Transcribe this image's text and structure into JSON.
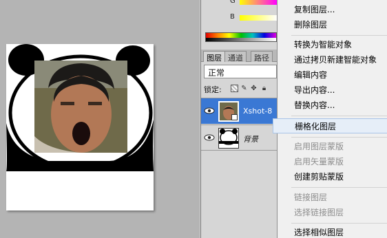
{
  "color_panel": {
    "g_channel": "G",
    "b_channel": "B"
  },
  "layers_panel": {
    "tabs": [
      "图层",
      "通道",
      "路径"
    ],
    "blend_mode": "正常",
    "lock_label": "锁定:",
    "layers": [
      {
        "name": "Xshot-8",
        "selected": true,
        "smart_object": true
      },
      {
        "name": "背景",
        "selected": false,
        "smart_object": false
      }
    ]
  },
  "context_menu": {
    "items": [
      {
        "label": "复制图层...",
        "enabled": true
      },
      {
        "label": "删除图层",
        "enabled": true
      },
      {
        "label": "转换为智能对象",
        "enabled": true
      },
      {
        "label": "通过拷贝新建智能对象",
        "enabled": true
      },
      {
        "label": "编辑内容",
        "enabled": true
      },
      {
        "label": "导出内容...",
        "enabled": true
      },
      {
        "label": "替换内容...",
        "enabled": true
      },
      {
        "label": "栅格化图层",
        "enabled": true,
        "hovered": true
      },
      {
        "label": "启用图层蒙版",
        "enabled": false
      },
      {
        "label": "启用矢量蒙版",
        "enabled": false
      },
      {
        "label": "创建剪贴蒙版",
        "enabled": true
      },
      {
        "label": "链接图层",
        "enabled": false
      },
      {
        "label": "选择链接图层",
        "enabled": false
      },
      {
        "label": "选择相似图层",
        "enabled": true
      }
    ]
  },
  "colors": {
    "selection": "#3a78d4",
    "menu_hover": "#e6eef8",
    "disabled_text": "#8c8c8c"
  }
}
